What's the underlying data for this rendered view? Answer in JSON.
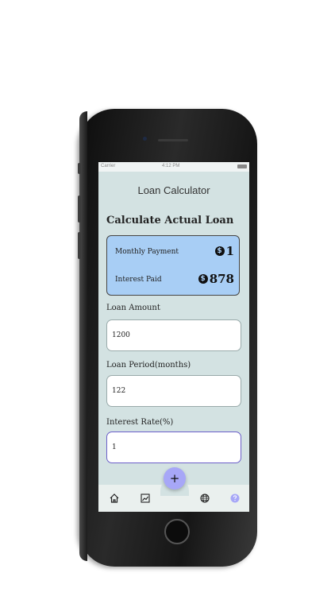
{
  "status_bar": {
    "carrier": "Carrier",
    "time": "4:12 PM"
  },
  "app": {
    "title": "Loan Calculator",
    "section_title": "Calculate Actual Loan"
  },
  "results": {
    "monthly_payment_label": "Monthly Payment",
    "monthly_payment_value": "1",
    "interest_paid_label": "Interest Paid",
    "interest_paid_value": "878",
    "currency_icon": "dollar-circle-icon"
  },
  "form": {
    "loan_amount_label": "Loan Amount",
    "loan_amount_value": "1200",
    "loan_period_label": "Loan Period(months)",
    "loan_period_value": "122",
    "interest_rate_label": "Interest Rate(%)",
    "interest_rate_value": "1"
  },
  "tab_bar": {
    "fab_label": "+",
    "items": [
      "home-icon",
      "chart-icon",
      "globe-icon",
      "help-icon"
    ]
  },
  "colors": {
    "screen_background": "#d3e2e2",
    "card_background": "#a8cef5",
    "fab": "#a7a7f7",
    "focus_border": "#6b5fc9",
    "help_icon": "#a7a7f7"
  }
}
